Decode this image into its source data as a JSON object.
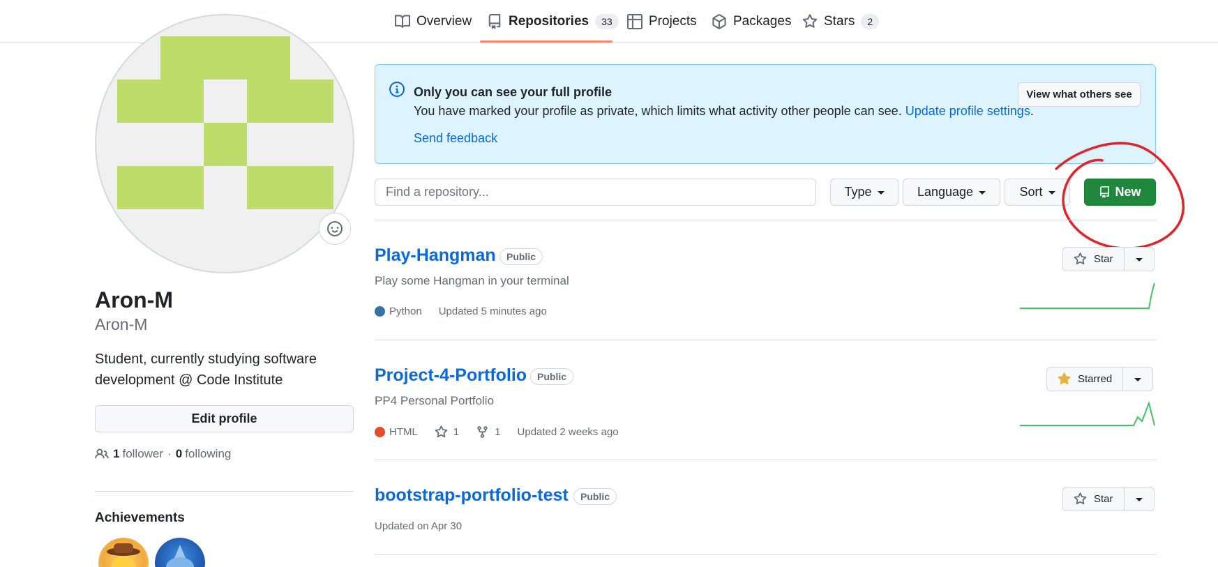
{
  "nav": {
    "tabs": [
      {
        "label": "Overview",
        "icon": "book-icon"
      },
      {
        "label": "Repositories",
        "icon": "repo-icon",
        "count": "33"
      },
      {
        "label": "Projects",
        "icon": "table-icon"
      },
      {
        "label": "Packages",
        "icon": "package-icon"
      },
      {
        "label": "Stars",
        "icon": "star-icon",
        "count": "2"
      }
    ]
  },
  "profile": {
    "fullname": "Aron-M",
    "username": "Aron-M",
    "bio": "Student, currently studying software development @ Code Institute",
    "edit_label": "Edit profile",
    "followers": "1",
    "followers_label": "follower",
    "following": "0",
    "following_label": "following",
    "separator": "·",
    "achievements_title": "Achievements"
  },
  "banner": {
    "title": "Only you can see your full profile",
    "text": "You have marked your profile as private, which limits what activity other people can see.",
    "link": "Update profile settings",
    "period": ".",
    "feedback": "Send feedback",
    "button": "View what others see"
  },
  "filters": {
    "search_placeholder": "Find a repository...",
    "type": "Type",
    "language": "Language",
    "sort": "Sort",
    "new": "New"
  },
  "repos": [
    {
      "name": "Play-Hangman",
      "visibility": "Public",
      "description": "Play some Hangman in your terminal",
      "language": "Python",
      "language_color": "#3572A5",
      "updated": "Updated 5 minutes ago",
      "star_label": "Star",
      "starred": false
    },
    {
      "name": "Project-4-Portfolio",
      "visibility": "Public",
      "description": "PP4 Personal Portfolio",
      "language": "HTML",
      "language_color": "#e34c26",
      "stars": "1",
      "forks": "1",
      "updated": "Updated 2 weeks ago",
      "star_label": "Starred",
      "starred": true
    },
    {
      "name": "bootstrap-portfolio-test",
      "visibility": "Public",
      "updated": "Updated on Apr 30",
      "star_label": "Star",
      "starred": false
    }
  ],
  "colors": {
    "accent": "#0969da",
    "new_button": "#1f883d",
    "avatar_fill": "#bedc6a",
    "annotation": "#e0242a"
  }
}
